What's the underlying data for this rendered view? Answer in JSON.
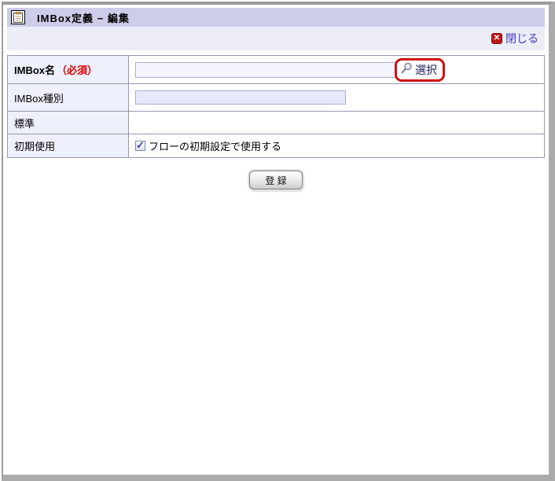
{
  "window": {
    "title": "IMBox定義 − 編集",
    "close_label": "閉じる"
  },
  "icons": {
    "title_icon": "clipboard-icon",
    "close_glyph": "✕",
    "select_icon": "magnifier-icon",
    "checkmark_glyph": "✓"
  },
  "form": {
    "rows": [
      {
        "label": "IMBox名",
        "required": "（必須）",
        "input_value": "",
        "select_label": "選択"
      },
      {
        "label": "IMBox種別",
        "input_value": ""
      },
      {
        "label": "標準",
        "value": ""
      },
      {
        "label": "初期使用",
        "checkbox_checked": true,
        "checkbox_label": "フローの初期設定で使用する"
      }
    ],
    "submit_label": "登 録"
  },
  "colors": {
    "titlebar_bg": "#cdcdea",
    "toolbar_bg": "#ededf8",
    "label_cell_bg": "#eef0fb",
    "link_color": "#3c3cc2",
    "required_color": "#e00000",
    "annotation_highlight": "#cc1111",
    "close_icon_bg": "#c01818"
  }
}
